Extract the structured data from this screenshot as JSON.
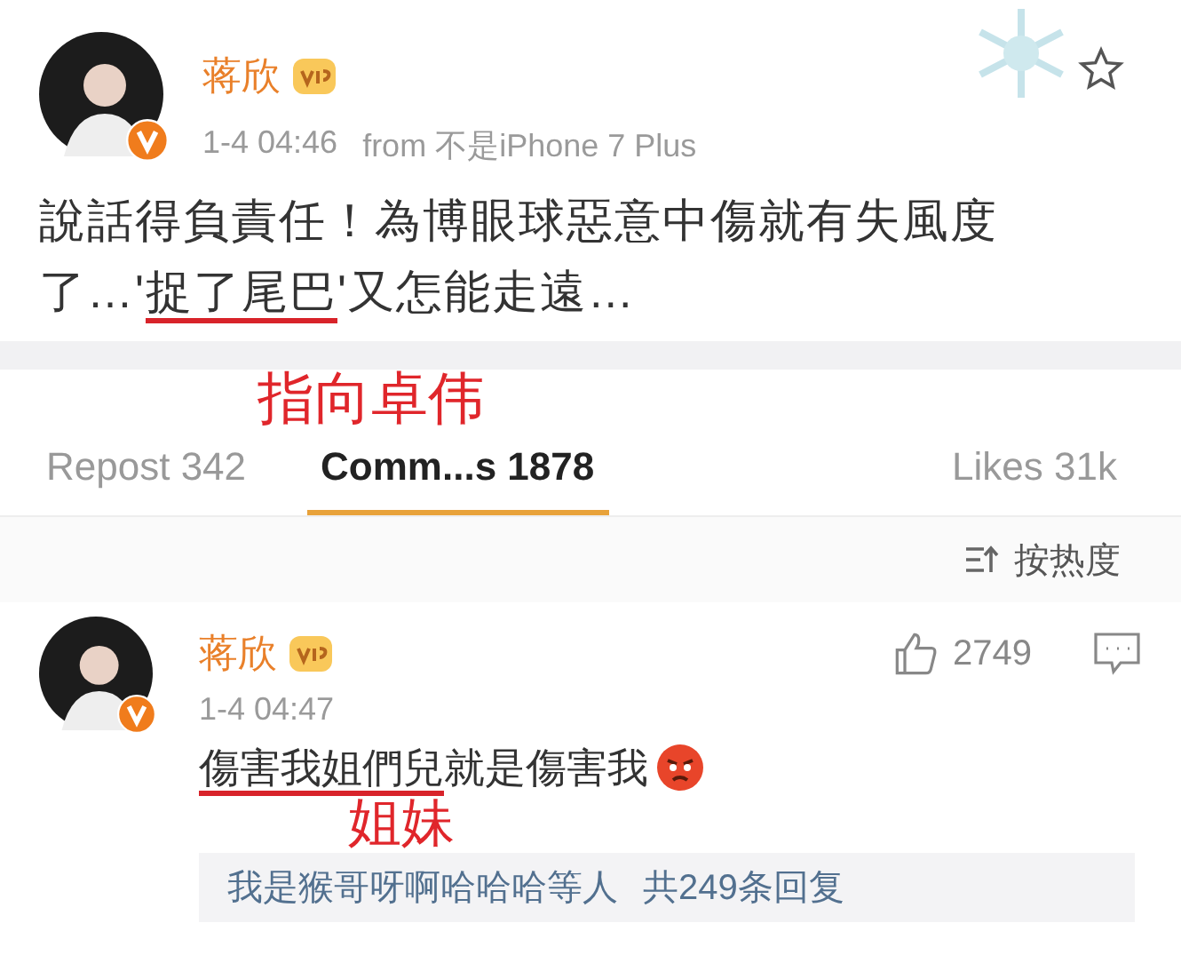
{
  "post": {
    "author": "蒋欣",
    "time": "1-4 04:46",
    "source": "from 不是iPhone 7 Plus",
    "favorited": false,
    "body": [
      {
        "text": "說話得負責任！為博眼球惡意中傷就有失風度了…'",
        "underlined": false
      },
      {
        "text": "捉了尾巴",
        "underlined": true
      },
      {
        "text": "'又怎能走遠…",
        "underlined": false
      }
    ],
    "note": "指向卓伟"
  },
  "tabs": [
    {
      "label": "Repost 342",
      "selected": false
    },
    {
      "label": "Comm...s 1878",
      "selected": true
    },
    {
      "label": "Likes 31k",
      "selected": false
    }
  ],
  "sort": {
    "label": "按热度"
  },
  "comment": {
    "author": "蒋欣",
    "time": "1-4 04:47",
    "likes": "2749",
    "body": [
      {
        "text": "傷害我姐們兒",
        "underlined": true
      },
      {
        "text": "就是傷害我",
        "underlined": false
      }
    ],
    "note": "姐妹",
    "replies": {
      "names": "我是猴哥呀啊哈哈哈等人",
      "count": "共249条回复"
    }
  }
}
